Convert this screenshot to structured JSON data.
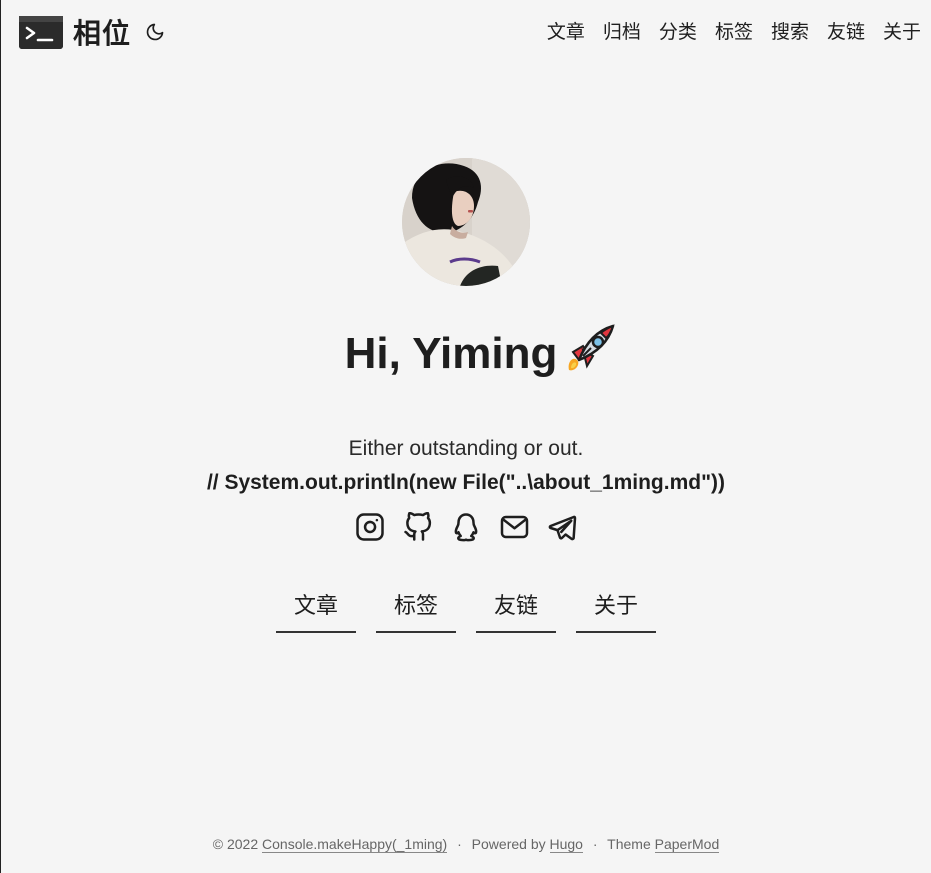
{
  "header": {
    "logo_text": "相位",
    "nav": [
      "文章",
      "归档",
      "分类",
      "标签",
      "搜索",
      "友链",
      "关于"
    ]
  },
  "profile": {
    "title": "Hi, Yiming",
    "subtitle": "Either outstanding or out.",
    "code": "// System.out.println(new File(\"..\\about_1ming.md\"))",
    "socials": [
      "instagram-icon",
      "github-icon",
      "qq-icon",
      "email-icon",
      "telegram-icon"
    ],
    "buttons": [
      "文章",
      "标签",
      "友链",
      "关于"
    ]
  },
  "footer": {
    "copyright": "© 2022",
    "site_link": "Console.makeHappy(_1ming)",
    "powered_by": "Powered by",
    "hugo": "Hugo",
    "theme": "Theme",
    "papermod": "PaperMod"
  }
}
